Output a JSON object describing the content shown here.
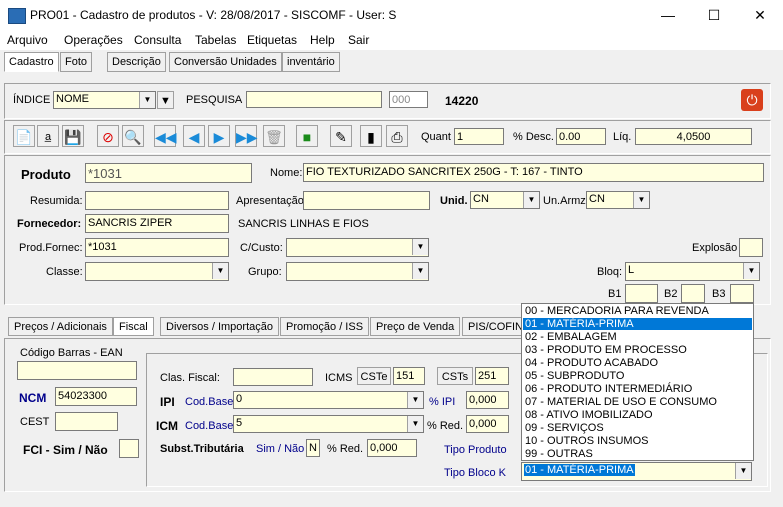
{
  "window": {
    "title": "PRO01 - Cadastro de produtos - V: 28/08/2017 - SISCOMF - User: S"
  },
  "menu": [
    "Arquivo",
    "Operações",
    "Consulta",
    "Tabelas",
    "Etiquetas",
    "Help",
    "Sair"
  ],
  "main_tabs": [
    "Cadastro",
    "Foto",
    "Descrição",
    "Conversão Unidades",
    "inventário"
  ],
  "search": {
    "index_label": "ÍNDICE",
    "index_value": "NOME",
    "search_label": "PESQUISA",
    "search_value": "",
    "code_value": "000",
    "record_number": "14220"
  },
  "toolbar": {
    "quant_label": "Quant",
    "quant_value": "1",
    "desc_label": "% Desc.",
    "desc_value": "0.00",
    "liq_label": "Líq.",
    "liq_value": "4,0500"
  },
  "produto": {
    "label": "Produto",
    "code": "*1031",
    "nome_label": "Nome:",
    "nome": "FIO TEXTURIZADO SANCRITEX 250G - T: 167 - TINTO",
    "resumida_label": "Resumida:",
    "resumida": "",
    "apresentacao_label": "Apresentação",
    "apresentacao": "",
    "unid_label": "Unid.",
    "unid": "CN",
    "unarmz_label": "Un.Armz",
    "unarmz": "CN",
    "fornecedor_label": "Fornecedor:",
    "fornecedor": "SANCRIS ZIPER",
    "fornecedor_nome": "SANCRIS LINHAS E FIOS",
    "prodfornec_label": "Prod.Fornec:",
    "prodfornec": "*1031",
    "ccusto_label": "C/Custo:",
    "ccusto": "",
    "explosao_label": "Explosão",
    "explosao": "",
    "classe_label": "Classe:",
    "classe": "",
    "grupo_label": "Grupo:",
    "grupo": "",
    "bloq_label": "Bloq:",
    "bloq": "L",
    "b1_label": "B1",
    "b2_label": "B2",
    "b3_label": "B3"
  },
  "sub_tabs": [
    "Preços / Adicionais",
    "Fiscal",
    "Diversos / Importação",
    "Promoção / ISS",
    "Preço de Venda",
    "PIS/COFIN"
  ],
  "fiscal": {
    "ean_label": "Código Barras - EAN",
    "ean": "",
    "ncm_label": "NCM",
    "ncm": "54023300",
    "cest_label": "CEST",
    "cest": "",
    "fci_label": "FCI - Sim / Não",
    "fci": "",
    "clas_label": "Clas. Fiscal:",
    "clas": "",
    "icms_label": "ICMS",
    "cste_btn": "CSTe",
    "cste": "151",
    "csts_btn": "CSTs",
    "csts": "251",
    "ipi_label": "IPI",
    "ipi_codbase_label": "Cod.Base",
    "ipi_codbase": "0",
    "ipi_pct_label": "% IPI",
    "ipi_pct": "0,000",
    "icm_label": "ICM",
    "icm_codbase_label": "Cod.Base",
    "icm_codbase": "5",
    "icm_red_label": "% Red.",
    "icm_red": "0,000",
    "subst_label": "Subst.Tributária",
    "simnao_label": "Sim / Não",
    "subst_val": "N",
    "subst_red_label": "% Red.",
    "subst_red": "0,000",
    "tipo_produto_label": "Tipo Produto",
    "tipo_bloco_label": "Tipo Bloco K",
    "tipo_bloco": "01 - MATÉRIA-PRIMA"
  },
  "dropdown": {
    "options": [
      "00 - MERCADORIA PARA REVENDA",
      "01 - MATÉRIA-PRIMA",
      "02 - EMBALAGEM",
      "03 - PRODUTO EM PROCESSO",
      "04 - PRODUTO ACABADO",
      "05 - SUBPRODUTO",
      "06 - PRODUTO INTERMEDIÁRIO",
      "07 - MATERIAL DE USO E CONSUMO",
      "08 - ATIVO IMOBILIZADO",
      "09 - SERVIÇOS",
      "10 - OUTROS INSUMOS",
      "99 - OUTRAS"
    ],
    "selected_index": 1
  },
  "colors": {
    "field_bg": "#ffffe0",
    "highlight": "#0078d7",
    "power_button": "#d9401c"
  }
}
